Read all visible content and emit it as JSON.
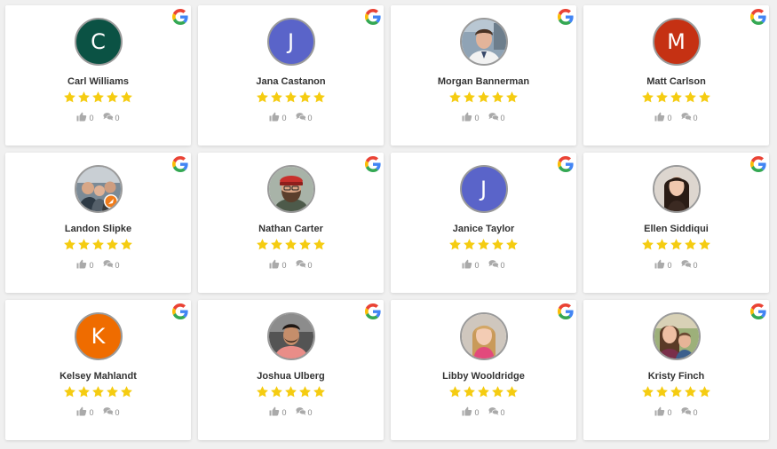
{
  "colors": {
    "star": "#f5cc11",
    "icon": "#aaaaaa",
    "avatar_border": "#9a9a9a"
  },
  "reviews": [
    {
      "name": "Carl Williams",
      "rating": 5,
      "likes": "0",
      "comments": "0",
      "avatar": {
        "type": "letter",
        "letter": "C",
        "bg": "#0b5244"
      }
    },
    {
      "name": "Jana Castanon",
      "rating": 5,
      "likes": "0",
      "comments": "0",
      "avatar": {
        "type": "letter",
        "letter": "J",
        "bg": "#5a64c9"
      }
    },
    {
      "name": "Morgan Bannerman",
      "rating": 5,
      "likes": "0",
      "comments": "0",
      "avatar": {
        "type": "photo",
        "photo": "man-window"
      }
    },
    {
      "name": "Matt Carlson",
      "rating": 5,
      "likes": "0",
      "comments": "0",
      "avatar": {
        "type": "letter",
        "letter": "M",
        "bg": "#c53113"
      }
    },
    {
      "name": "Landon Slipke",
      "rating": 5,
      "likes": "0",
      "comments": "0",
      "avatar": {
        "type": "photo",
        "photo": "group-badge"
      }
    },
    {
      "name": "Nathan Carter",
      "rating": 5,
      "likes": "0",
      "comments": "0",
      "avatar": {
        "type": "photo",
        "photo": "man-beard-cap"
      }
    },
    {
      "name": "Janice Taylor",
      "rating": 5,
      "likes": "0",
      "comments": "0",
      "avatar": {
        "type": "letter",
        "letter": "J",
        "bg": "#5a64c9"
      }
    },
    {
      "name": "Ellen Siddiqui",
      "rating": 5,
      "likes": "0",
      "comments": "0",
      "avatar": {
        "type": "photo",
        "photo": "woman-dark-hair"
      }
    },
    {
      "name": "Kelsey Mahlandt",
      "rating": 5,
      "likes": "0",
      "comments": "0",
      "avatar": {
        "type": "letter",
        "letter": "K",
        "bg": "#ef6c00"
      }
    },
    {
      "name": "Joshua Ulberg",
      "rating": 5,
      "likes": "0",
      "comments": "0",
      "avatar": {
        "type": "photo",
        "photo": "man-car"
      }
    },
    {
      "name": "Libby Wooldridge",
      "rating": 5,
      "likes": "0",
      "comments": "0",
      "avatar": {
        "type": "photo",
        "photo": "woman-blonde"
      }
    },
    {
      "name": "Kristy Finch",
      "rating": 5,
      "likes": "0",
      "comments": "0",
      "avatar": {
        "type": "photo",
        "photo": "woman-child"
      }
    }
  ],
  "icons": {
    "source": "google-logo-icon",
    "like": "thumbs-up-icon",
    "comment": "comment-bubbles-icon",
    "star": "star-icon"
  }
}
